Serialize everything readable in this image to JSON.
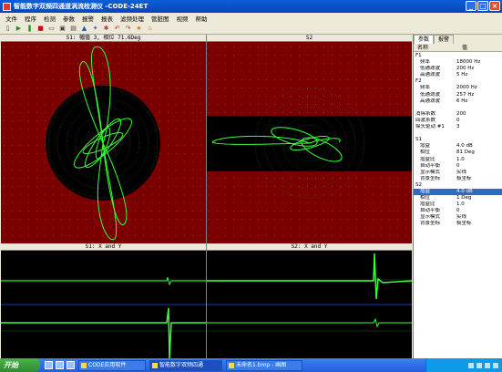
{
  "window": {
    "title": "智能数字双频四通道涡流检测仪 -CODE-24ET"
  },
  "menu": [
    "文件",
    "程序",
    "检测",
    "参数",
    "报警",
    "报表",
    "滤频处理",
    "管脏图",
    "视频",
    "帮助"
  ],
  "toolbar": {
    "icons": [
      "new-icon",
      "play-icon",
      "pause-icon",
      "stop-icon",
      "open-icon",
      "save-icon",
      "print-icon",
      "up-icon",
      "tool-icon",
      "gear-icon",
      "undo-icon",
      "redo-icon",
      "star-icon",
      "fire-icon"
    ]
  },
  "panels": {
    "s1_title": "S1: 幅值 3, 相位 71.6Deg",
    "s2_title": "S2",
    "s1_xy_title": "S1: X and Y",
    "s2_xy_title": "S2: X and Y"
  },
  "sidebar": {
    "tab_params": "参数",
    "tab_alarm": "报警",
    "col_name": "名称",
    "col_value": "值",
    "rows": [
      {
        "n": "F1",
        "v": "",
        "k": "sec"
      },
      {
        "n": "频率",
        "v": "18000 Hz",
        "k": "item"
      },
      {
        "n": "低通滤波",
        "v": "200 Hz",
        "k": "item"
      },
      {
        "n": "高通滤波",
        "v": "5 Hz",
        "k": "item"
      },
      {
        "n": "F2",
        "v": "",
        "k": "sec"
      },
      {
        "n": "频率",
        "v": "2000 Hz",
        "k": "item"
      },
      {
        "n": "低通滤波",
        "v": "257 Hz",
        "k": "item"
      },
      {
        "n": "高通滤波",
        "v": "6 Hz",
        "k": "item"
      },
      {
        "n": "",
        "v": "",
        "k": "sec"
      },
      {
        "n": "消除系数",
        "v": "200",
        "k": "sec"
      },
      {
        "n": "回波系数",
        "v": "0",
        "k": "sec"
      },
      {
        "n": "探头驱动 #1",
        "v": "3",
        "k": "sec"
      },
      {
        "n": "",
        "v": "",
        "k": "sec"
      },
      {
        "n": "S1",
        "v": "",
        "k": "sec"
      },
      {
        "n": "增益",
        "v": "4.0 dB",
        "k": "item"
      },
      {
        "n": "相位",
        "v": "81 Deg",
        "k": "item"
      },
      {
        "n": "增益比",
        "v": "1.0",
        "k": "item"
      },
      {
        "n": "自动平衡",
        "v": "0",
        "k": "item"
      },
      {
        "n": "显示模式",
        "v": "实线",
        "k": "item"
      },
      {
        "n": "背景坐标",
        "v": "极坐标",
        "k": "item"
      },
      {
        "n": "S2",
        "v": "",
        "k": "sec"
      },
      {
        "n": "增益",
        "v": "4.0 dB",
        "k": "item",
        "sel": true
      },
      {
        "n": "相位",
        "v": "1 Deg",
        "k": "item"
      },
      {
        "n": "增益比",
        "v": "1.0",
        "k": "item"
      },
      {
        "n": "自动平衡",
        "v": "0",
        "k": "item"
      },
      {
        "n": "显示模式",
        "v": "实线",
        "k": "item"
      },
      {
        "n": "背景坐标",
        "v": "极坐标",
        "k": "item"
      }
    ]
  },
  "taskbar": {
    "start": "开始",
    "tasks": [
      "CODE应用软件",
      "智能数字双频四通",
      "未命名1.bmp - 画图"
    ],
    "active": 1
  },
  "colors": {
    "plot_bg": "#7a0000",
    "trace": "#39ff39",
    "select": "#316ac5"
  }
}
